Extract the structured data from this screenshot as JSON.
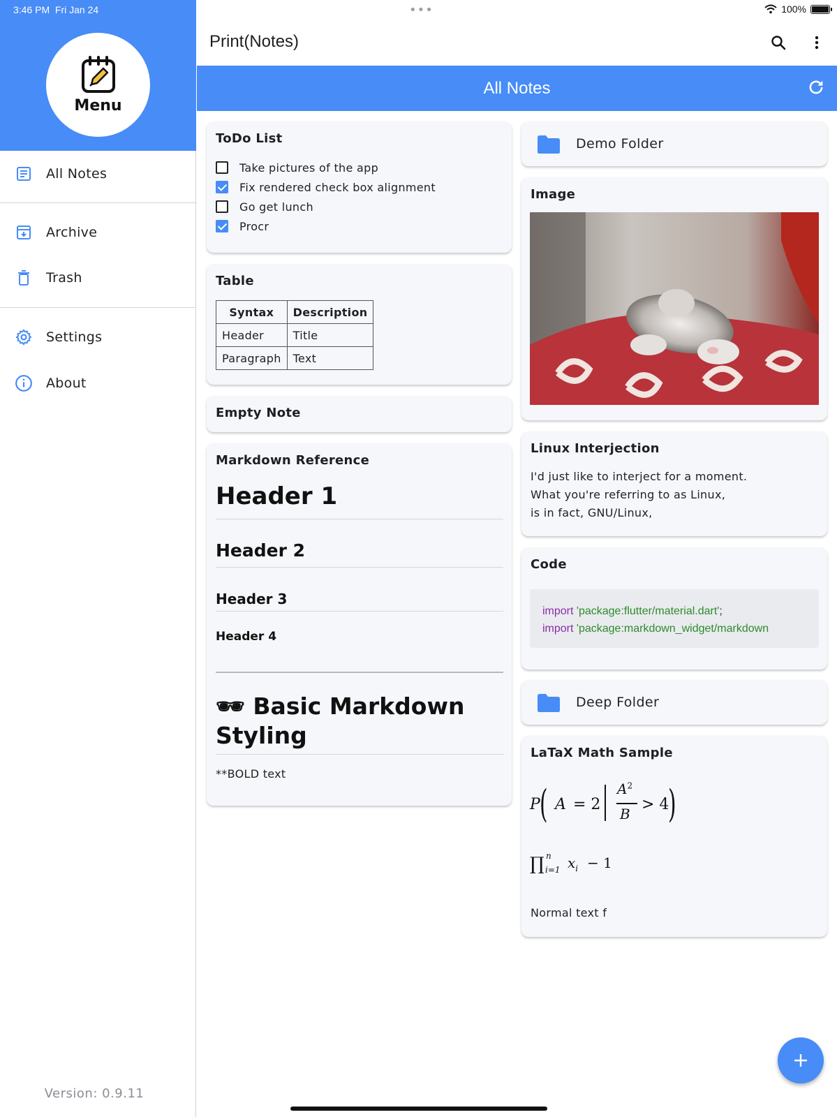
{
  "status_bar": {
    "time": "3:46 PM",
    "date": "Fri Jan 24",
    "battery": "100%"
  },
  "sidebar": {
    "header_label": "Menu",
    "items": [
      {
        "label": "All Notes",
        "icon": "notes-icon"
      },
      {
        "label": "Archive",
        "icon": "archive-icon"
      },
      {
        "label": "Trash",
        "icon": "trash-icon"
      },
      {
        "label": "Settings",
        "icon": "gear-icon"
      },
      {
        "label": "About",
        "icon": "info-icon"
      }
    ],
    "version": "Version: 0.9.11"
  },
  "app": {
    "title": "Print(Notes)",
    "section_title": "All Notes",
    "accent": "#478cf7"
  },
  "notes": {
    "todo": {
      "title": "ToDo List",
      "items": [
        {
          "text": "Take pictures of the app",
          "checked": false
        },
        {
          "text": "Fix rendered check box alignment",
          "checked": true
        },
        {
          "text": "Go get lunch",
          "checked": false
        },
        {
          "text": "Procr",
          "checked": true
        }
      ]
    },
    "table": {
      "title": "Table",
      "headers": [
        "Syntax",
        "Description"
      ],
      "rows": [
        [
          "Header",
          "Title"
        ],
        [
          "Paragraph",
          "Text"
        ]
      ]
    },
    "empty": {
      "title": "Empty Note"
    },
    "markdown": {
      "title": "Markdown Reference",
      "h1": "Header 1",
      "h2": "Header 2",
      "h3": "Header 3",
      "h4": "Header 4",
      "emoji": "🕶",
      "big_heading": "Basic Markdown Styling",
      "body": "**BOLD text"
    },
    "demo_folder": {
      "label": "Demo Folder"
    },
    "image": {
      "title": "Image"
    },
    "linux": {
      "title": "Linux Interjection",
      "lines": [
        "I'd just like to interject for a moment.",
        "What you're referring to as Linux,",
        "is in fact, GNU/Linux,"
      ]
    },
    "code": {
      "title": "Code",
      "keyword": "import",
      "line1_string": "'package:flutter/material.dart'",
      "line1_end": ";",
      "line2_string": "'package:markdown_widget/markdown"
    },
    "deep_folder": {
      "label": "Deep Folder"
    },
    "latex": {
      "title": "LaTaX Math Sample",
      "formula1_P": "P",
      "formula1_A": "A",
      "formula1_eq": "= 2",
      "formula1_num": "A",
      "formula1_exp": "2",
      "formula1_den": "B",
      "formula1_gt": "> 4",
      "formula2_prod": "∏",
      "formula2_sup": "n",
      "formula2_sub": "i=1",
      "formula2_body": "x",
      "formula2_bodysub": "i",
      "formula2_tail": "− 1",
      "normal": "Normal text f"
    }
  }
}
